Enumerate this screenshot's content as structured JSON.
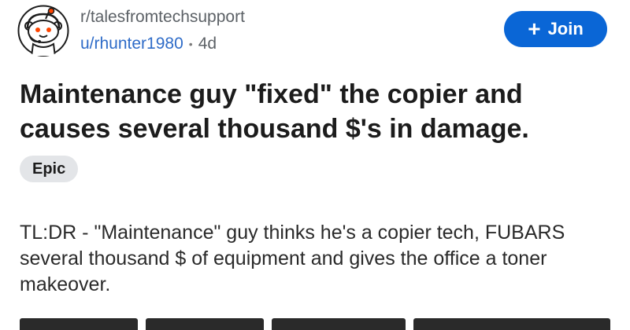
{
  "header": {
    "subreddit": "r/talesfromtechsupport",
    "username": "u/rhunter1980",
    "separator": "•",
    "age": "4d",
    "avatar_icon": "snoo-avatar-icon"
  },
  "join_button": {
    "icon": "plus-icon",
    "label": "Join",
    "color": "#0a66d6"
  },
  "post": {
    "title": "Maintenance guy \"fixed\" the copier and causes several thousand $'s in damage.",
    "flair": "Epic",
    "body": "TL:DR - \"Maintenance\" guy thinks he's a copier tech, FUBARS several thousand $ of equipment and gives the office a toner makeover."
  },
  "colors": {
    "username": "#2f6cc8",
    "meta_gray": "#5c6166",
    "flair_bg": "#e3e5e8"
  }
}
